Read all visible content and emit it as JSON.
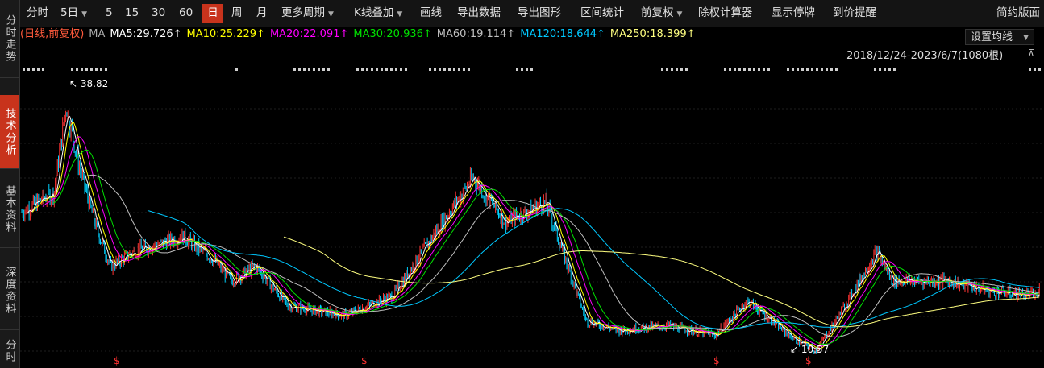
{
  "nav": [
    {
      "label": "分时走势",
      "active": false
    },
    {
      "label": "技术分析",
      "active": true
    },
    {
      "label": "基本资料",
      "active": false
    },
    {
      "label": "深度资料",
      "active": false
    },
    {
      "label": "分时",
      "active": false
    }
  ],
  "toolbar": {
    "items": [
      "分时",
      "5日",
      "5",
      "15",
      "30",
      "60",
      "日",
      "周",
      "月",
      "更多周期",
      "K线叠加",
      "画线",
      "导出数据",
      "导出图形",
      "区间统计",
      "前复权",
      "除权计算器",
      "显示停牌",
      "到价提醒",
      "简约版面"
    ],
    "active": "日"
  },
  "ma": {
    "prefix": "(日线,前复权)",
    "label": "MA",
    "items": [
      {
        "text": "MA5:29.726↑",
        "color": "#ffffff"
      },
      {
        "text": "MA10:25.229↑",
        "color": "#ffff00"
      },
      {
        "text": "MA20:22.091↑",
        "color": "#ff00ff"
      },
      {
        "text": "MA30:20.936↑",
        "color": "#00e000"
      },
      {
        "text": "MA60:19.114↑",
        "color": "#c0c0c0"
      },
      {
        "text": "MA120:18.644↑",
        "color": "#00c8ff"
      },
      {
        "text": "MA250:18.399↑",
        "color": "#ffff80"
      }
    ],
    "setting_label": "设置均线"
  },
  "range_label": "2018/12/24-2023/6/7(1080根)",
  "high_label": "38.82",
  "low_label": "10.57",
  "colors": {
    "up": "#ff3232",
    "down": "#00d2ff",
    "accent": "#c8331c"
  },
  "chart_data": {
    "type": "candlestick",
    "count": 1080,
    "high": 38.82,
    "low": 10.57,
    "ma_values": {
      "MA5": 29.726,
      "MA10": 25.229,
      "MA20": 22.091,
      "MA30": 20.936,
      "MA60": 19.114,
      "MA120": 18.644,
      "MA250": 18.399
    }
  }
}
